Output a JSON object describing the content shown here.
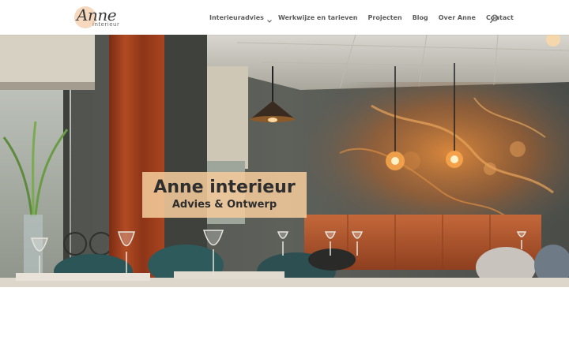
{
  "brand": {
    "logo_script": "Anne",
    "logo_sub": "interieur"
  },
  "nav": {
    "items": [
      {
        "label": "Interieuradvies",
        "has_dropdown": true
      },
      {
        "label": "Werkwijze en tarieven",
        "has_dropdown": false
      },
      {
        "label": "Projecten",
        "has_dropdown": false
      },
      {
        "label": "Blog",
        "has_dropdown": false
      },
      {
        "label": "Over Anne",
        "has_dropdown": false
      },
      {
        "label": "Contact",
        "has_dropdown": false
      }
    ],
    "search_icon": "search-icon",
    "dropdown_icon": "chevron-down-icon"
  },
  "hero": {
    "title": "Anne interieur",
    "subtitle": "Advies & Ontwerp",
    "box_color": "#f3c99a"
  },
  "colors": {
    "nav_text": "#5b5b5b",
    "logo_circle": "#f6d9bf",
    "wall": "#5b5d58",
    "copper": "#c77a3e",
    "curtain": "#9a3d1e"
  }
}
